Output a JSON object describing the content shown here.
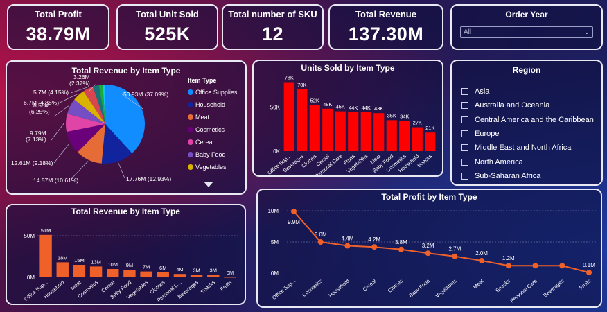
{
  "kpis": {
    "profit": {
      "title": "Total Profit",
      "value": "38.79M"
    },
    "units": {
      "title": "Total Unit Sold",
      "value": "525K"
    },
    "sku": {
      "title": "Total number of SKU",
      "value": "12"
    },
    "revenue": {
      "title": "Total Revenue",
      "value": "137.30M"
    }
  },
  "order_year": {
    "title": "Order Year",
    "selected": "All",
    "chevron": "chevron-down-icon"
  },
  "region": {
    "title": "Region",
    "items": [
      "Asia",
      "Australia and Oceania",
      "Central America and the Caribbean",
      "Europe",
      "Middle East and North Africa",
      "North America",
      "Sub-Saharan Africa"
    ]
  },
  "pie_panel": {
    "title": "Total Revenue by Item Type",
    "legend_title": "Item Type",
    "legend": [
      "Office Supplies",
      "Household",
      "Meat",
      "Cosmetics",
      "Cereal",
      "Baby Food",
      "Vegetables"
    ],
    "slice_labels": [
      "50.93M (37.09%)",
      "17.76M (12.93%)",
      "14.57M (10.61%)",
      "12.61M (9.18%)",
      "9.79M (7.13%)",
      "8.58M (6.25%)",
      "6.7M (4.88%)",
      "5.7M (4.15%)",
      "3.26M (2.37%)"
    ]
  },
  "units_panel": {
    "title": "Units Sold by Item Type",
    "yticks": [
      "0K",
      "50K"
    ]
  },
  "revbar_panel": {
    "title": "Total Revenue by Item Type",
    "yticks": [
      "0M",
      "50M"
    ]
  },
  "profit_panel": {
    "title": "Total Profit by Item Type",
    "yticks": [
      "0M",
      "5M",
      "10M"
    ]
  },
  "chart_data": [
    {
      "type": "pie",
      "title": "Total Revenue by Item Type",
      "legend_title": "Item Type",
      "categories": [
        "Office Supplies",
        "Household",
        "Meat",
        "Cosmetics",
        "Cereal",
        "Baby Food",
        "Vegetables",
        "",
        ""
      ],
      "values": [
        50.93,
        17.76,
        14.57,
        12.61,
        9.79,
        8.58,
        6.7,
        5.7,
        3.26
      ],
      "labels": [
        "50.93M (37.09%)",
        "17.76M (12.93%)",
        "14.57M (10.61%)",
        "12.61M (9.18%)",
        "9.79M (7.13%)",
        "8.58M (6.25%)",
        "6.7M (4.88%)",
        "5.7M (4.15%)",
        "3.26M (2.37%)"
      ],
      "colors": [
        "#118dff",
        "#12239e",
        "#e66c37",
        "#6b007b",
        "#e044a7",
        "#744ec2",
        "#d9b300",
        "#d64550",
        "#197278"
      ],
      "extra_slice_colors": [
        "#1aab40",
        "#15c6f4"
      ],
      "legend_placement": "right"
    },
    {
      "type": "bar",
      "title": "Units Sold by Item Type",
      "categories": [
        "Office Sup...",
        "Beverages",
        "Clothes",
        "Cereal",
        "Personal Care",
        "Fruits",
        "Vegetables",
        "Meat",
        "Baby Food",
        "Cosmetics",
        "Household",
        "Snacks"
      ],
      "values": [
        78,
        70,
        52,
        48,
        45,
        44,
        44,
        43,
        35,
        34,
        27,
        21
      ],
      "labels": [
        "78K",
        "70K",
        "52K",
        "48K",
        "45K",
        "44K",
        "44K",
        "43K",
        "35K",
        "34K",
        "27K",
        "21K"
      ],
      "ylim": [
        0,
        80
      ],
      "yticks": [
        0,
        50
      ],
      "unit": "K",
      "color": "#ff0000"
    },
    {
      "type": "bar",
      "title": "Total Revenue by Item Type",
      "categories": [
        "Office Sup...",
        "Household",
        "Meat",
        "Cosmetics",
        "Cereal",
        "Baby Food",
        "Vegetables",
        "Clothes",
        "Personal C...",
        "Beverages",
        "Snacks",
        "Fruits"
      ],
      "values": [
        51,
        18,
        15,
        13,
        10,
        9,
        7,
        6,
        4,
        3,
        3,
        0
      ],
      "labels": [
        "51M",
        "18M",
        "15M",
        "13M",
        "10M",
        "9M",
        "7M",
        "6M",
        "4M",
        "3M",
        "3M",
        "0M"
      ],
      "ylim": [
        0,
        55
      ],
      "yticks": [
        0,
        50
      ],
      "unit": "M",
      "color": "#f0612a"
    },
    {
      "type": "line",
      "title": "Total Profit by Item Type",
      "categories": [
        "Office Sup...",
        "Cosmetics",
        "Household",
        "Cereal",
        "Clothes",
        "Baby Food",
        "Vegetables",
        "Meat",
        "Snacks",
        "Personal Care",
        "Beverages",
        "Fruits"
      ],
      "values": [
        9.9,
        5.0,
        4.4,
        4.2,
        3.8,
        3.2,
        2.7,
        2.0,
        1.2,
        1.2,
        1.2,
        0.1
      ],
      "labels": [
        "9.9M",
        "5.0M",
        "4.4M",
        "4.2M",
        "3.8M",
        "3.2M",
        "2.7M",
        "2.0M",
        "1.2M",
        "",
        "",
        "0.1M"
      ],
      "ylim": [
        0,
        10
      ],
      "yticks": [
        0,
        5,
        10
      ],
      "unit": "M",
      "color": "#f0612a"
    }
  ]
}
